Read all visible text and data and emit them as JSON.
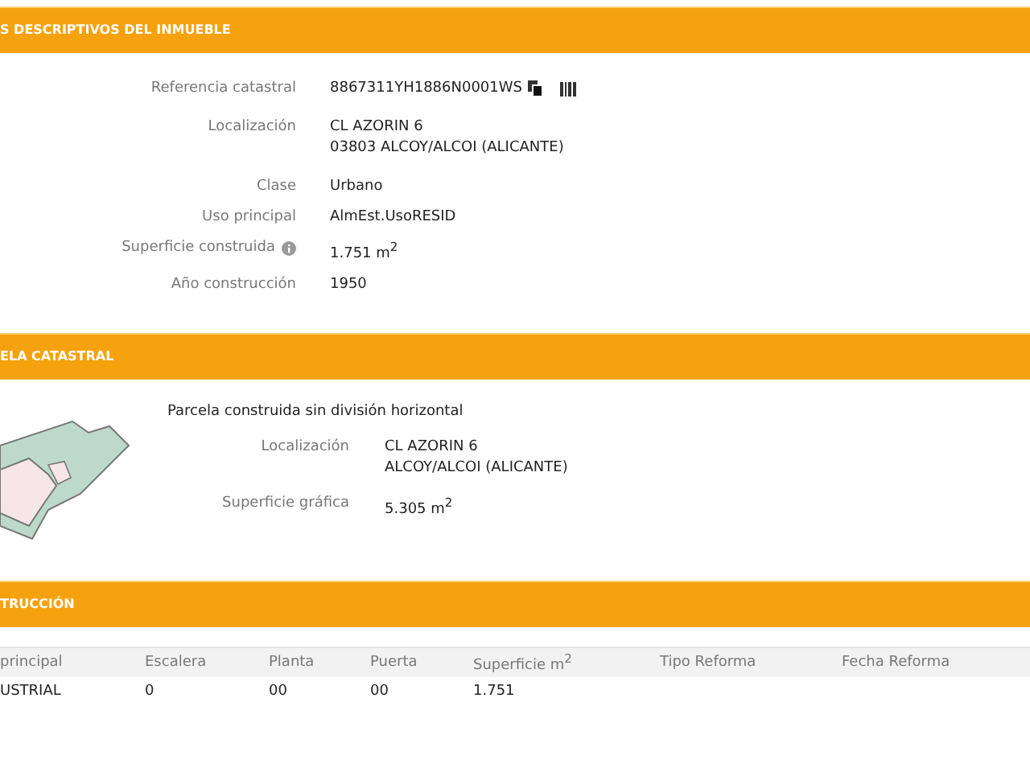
{
  "sections": [
    {
      "title": "S DESCRIPTIVOS DEL INMUEBLE",
      "kind": "fields",
      "fields": [
        {
          "label": "Referencia catastral",
          "lines": [
            "8867311YH1886N0001WS"
          ],
          "icons": true
        },
        {
          "label": "Localización",
          "lines": [
            "CL AZORIN 6",
            "03803 ALCOY/ALCOI (ALICANTE)"
          ]
        },
        {
          "label": "Clase",
          "lines": [
            "Urbano"
          ]
        },
        {
          "label": "Uso principal",
          "lines": [
            "AlmEst.UsoRESID"
          ]
        },
        {
          "label": "Superficie construida",
          "lines": [
            "1.751 m$^{2}$"
          ],
          "info": true
        },
        {
          "label": "Año construcción",
          "lines": [
            "1950"
          ]
        }
      ]
    },
    {
      "title": "ELA CATASTRAL",
      "kind": "parcel",
      "description": "Parcela construida sin división horizontal",
      "fields": [
        {
          "label": "Localización",
          "lines": [
            "CL AZORIN 6",
            "ALCOY/ALCOI (ALICANTE)"
          ]
        },
        {
          "label": "Superficie gráfica",
          "lines": [
            "5.305 m$^{2}$"
          ]
        }
      ]
    },
    {
      "title": "TRUCCIÓN",
      "kind": "table",
      "columns": [
        "principal",
        "Escalera",
        "Planta",
        "Puerta",
        "Superficie m$^{2}$",
        "Tipo Reforma",
        "Fecha Reforma"
      ],
      "rows": [
        [
          "USTRIAL",
          "0",
          "00",
          "00",
          "1.751",
          "",
          ""
        ]
      ]
    }
  ]
}
